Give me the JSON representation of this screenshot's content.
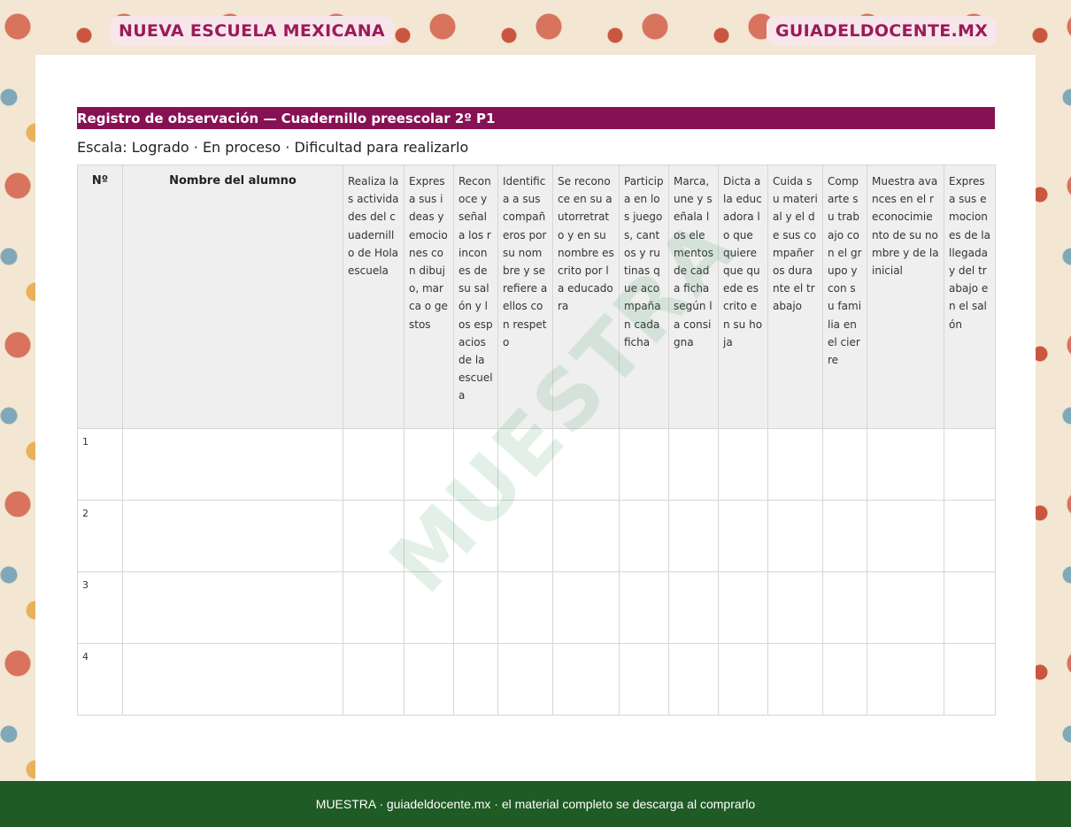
{
  "header": {
    "left_brand": "NUEVA ESCUELA MEXICANA",
    "right_brand": "GUIADELDOCENTE.MX"
  },
  "document": {
    "title": "Registro de observación — Cuadernillo preescolar 2º P1",
    "scale": "Escala: Logrado · En proceso · Dificultad para realizarlo"
  },
  "table": {
    "headers": [
      "Nº",
      "Nombre del alumno",
      "Realiza las actividades del cuadernillo de Hola escuela",
      "Expresa sus ideas y emociones con dibujo, marca o gestos",
      "Reconoce y señala los rincones de su salón y los espacios de la escuela",
      "Identifica a sus compañeros por su nombre y se refiere a ellos con respeto",
      "Se reconoce en su autorretrato y en su nombre escrito por la educadora",
      "Participa en los juegos, cantos y rutinas que acompañan cada ficha",
      "Marca, une y señala los elementos de cada ficha según la consigna",
      "Dicta a la educadora lo que quiere que quede escrito en su hoja",
      "Cuida su material y el de sus compañeros durante el trabajo",
      "Comparte su trabajo con el grupo y con su familia en el cierre",
      "Muestra avances en el reconocimiento de su nombre y de la inicial",
      "Expresa sus emociones de la llegada y del trabajo en el salón"
    ],
    "rows": [
      "1",
      "2",
      "3",
      "4"
    ]
  },
  "watermark": "MUESTRA",
  "footer": {
    "text": "MUESTRA · guiadeldocente.mx · el material completo se descarga al comprarlo"
  }
}
